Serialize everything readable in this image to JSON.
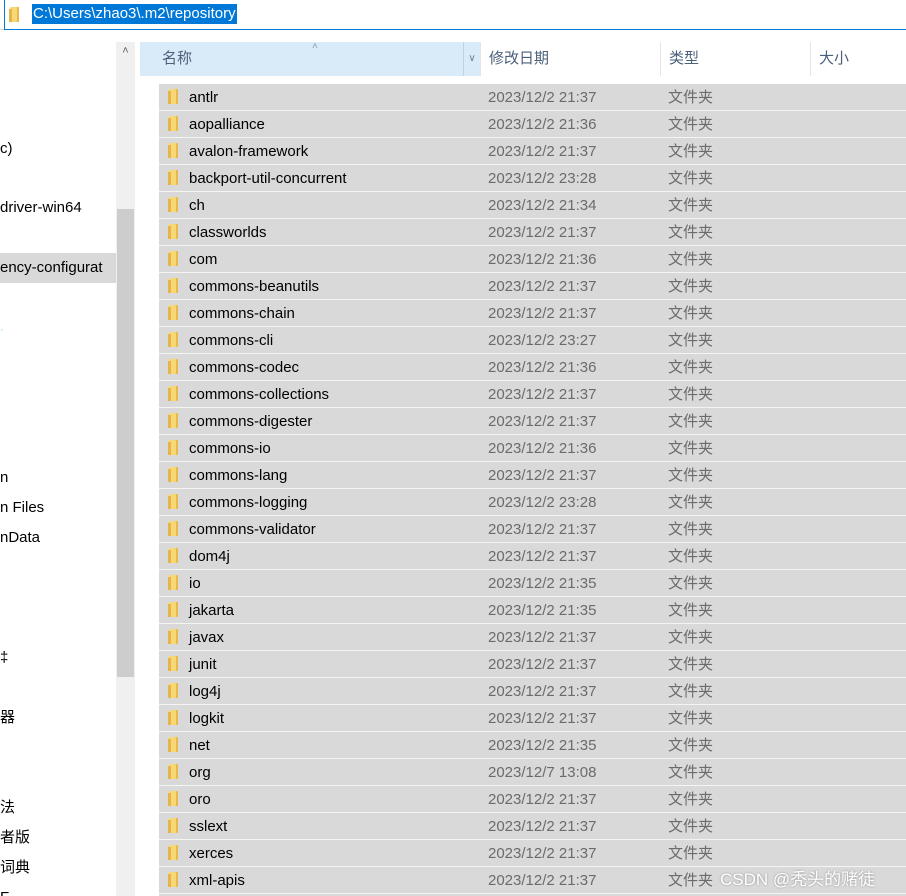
{
  "address_bar": {
    "path": "C:\\Users\\zhao3\\.m2\\repository"
  },
  "nav_pane": {
    "items": [
      {
        "label": "c)",
        "selected": false
      },
      {
        "label": "driver-win64",
        "selected": false
      },
      {
        "label": "ency-configurat",
        "selected": true
      },
      {
        "label": "n",
        "selected": false
      },
      {
        "label": "n Files",
        "selected": false
      },
      {
        "label": "nData",
        "selected": false
      },
      {
        "label": "‡",
        "selected": false
      },
      {
        "label": "器",
        "selected": false
      },
      {
        "label": "法",
        "selected": false
      },
      {
        "label": "者版",
        "selected": false
      },
      {
        "label": "词典",
        "selected": false
      },
      {
        "label": "F",
        "selected": false
      }
    ]
  },
  "columns": {
    "name": "名称",
    "date": "修改日期",
    "type": "类型",
    "size": "大小"
  },
  "files": [
    {
      "name": "antlr",
      "date": "2023/12/2 21:37",
      "type": "文件夹"
    },
    {
      "name": "aopalliance",
      "date": "2023/12/2 21:36",
      "type": "文件夹"
    },
    {
      "name": "avalon-framework",
      "date": "2023/12/2 21:37",
      "type": "文件夹"
    },
    {
      "name": "backport-util-concurrent",
      "date": "2023/12/2 23:28",
      "type": "文件夹"
    },
    {
      "name": "ch",
      "date": "2023/12/2 21:34",
      "type": "文件夹"
    },
    {
      "name": "classworlds",
      "date": "2023/12/2 21:37",
      "type": "文件夹"
    },
    {
      "name": "com",
      "date": "2023/12/2 21:36",
      "type": "文件夹"
    },
    {
      "name": "commons-beanutils",
      "date": "2023/12/2 21:37",
      "type": "文件夹"
    },
    {
      "name": "commons-chain",
      "date": "2023/12/2 21:37",
      "type": "文件夹"
    },
    {
      "name": "commons-cli",
      "date": "2023/12/2 23:27",
      "type": "文件夹"
    },
    {
      "name": "commons-codec",
      "date": "2023/12/2 21:36",
      "type": "文件夹"
    },
    {
      "name": "commons-collections",
      "date": "2023/12/2 21:37",
      "type": "文件夹"
    },
    {
      "name": "commons-digester",
      "date": "2023/12/2 21:37",
      "type": "文件夹"
    },
    {
      "name": "commons-io",
      "date": "2023/12/2 21:36",
      "type": "文件夹"
    },
    {
      "name": "commons-lang",
      "date": "2023/12/2 21:37",
      "type": "文件夹"
    },
    {
      "name": "commons-logging",
      "date": "2023/12/2 23:28",
      "type": "文件夹"
    },
    {
      "name": "commons-validator",
      "date": "2023/12/2 21:37",
      "type": "文件夹"
    },
    {
      "name": "dom4j",
      "date": "2023/12/2 21:37",
      "type": "文件夹"
    },
    {
      "name": "io",
      "date": "2023/12/2 21:35",
      "type": "文件夹"
    },
    {
      "name": "jakarta",
      "date": "2023/12/2 21:35",
      "type": "文件夹"
    },
    {
      "name": "javax",
      "date": "2023/12/2 21:37",
      "type": "文件夹"
    },
    {
      "name": "junit",
      "date": "2023/12/2 21:37",
      "type": "文件夹"
    },
    {
      "name": "log4j",
      "date": "2023/12/2 21:37",
      "type": "文件夹"
    },
    {
      "name": "logkit",
      "date": "2023/12/2 21:37",
      "type": "文件夹"
    },
    {
      "name": "net",
      "date": "2023/12/2 21:35",
      "type": "文件夹"
    },
    {
      "name": "org",
      "date": "2023/12/7 13:08",
      "type": "文件夹"
    },
    {
      "name": "oro",
      "date": "2023/12/2 21:37",
      "type": "文件夹"
    },
    {
      "name": "sslext",
      "date": "2023/12/2 21:37",
      "type": "文件夹"
    },
    {
      "name": "xerces",
      "date": "2023/12/2 21:37",
      "type": "文件夹"
    },
    {
      "name": "xml-apis",
      "date": "2023/12/2 21:37",
      "type": "文件夹"
    }
  ],
  "watermark": "CSDN @秃头的赌徒",
  "colors": {
    "selection": "#d9d9d9",
    "address_highlight": "#0078d7",
    "header_active": "#d9ebf9",
    "folder": "#f8d775"
  },
  "icons": [
    "folder-icon",
    "chevron-up-icon",
    "chevron-down-icon",
    "sort-asc-icon"
  ]
}
